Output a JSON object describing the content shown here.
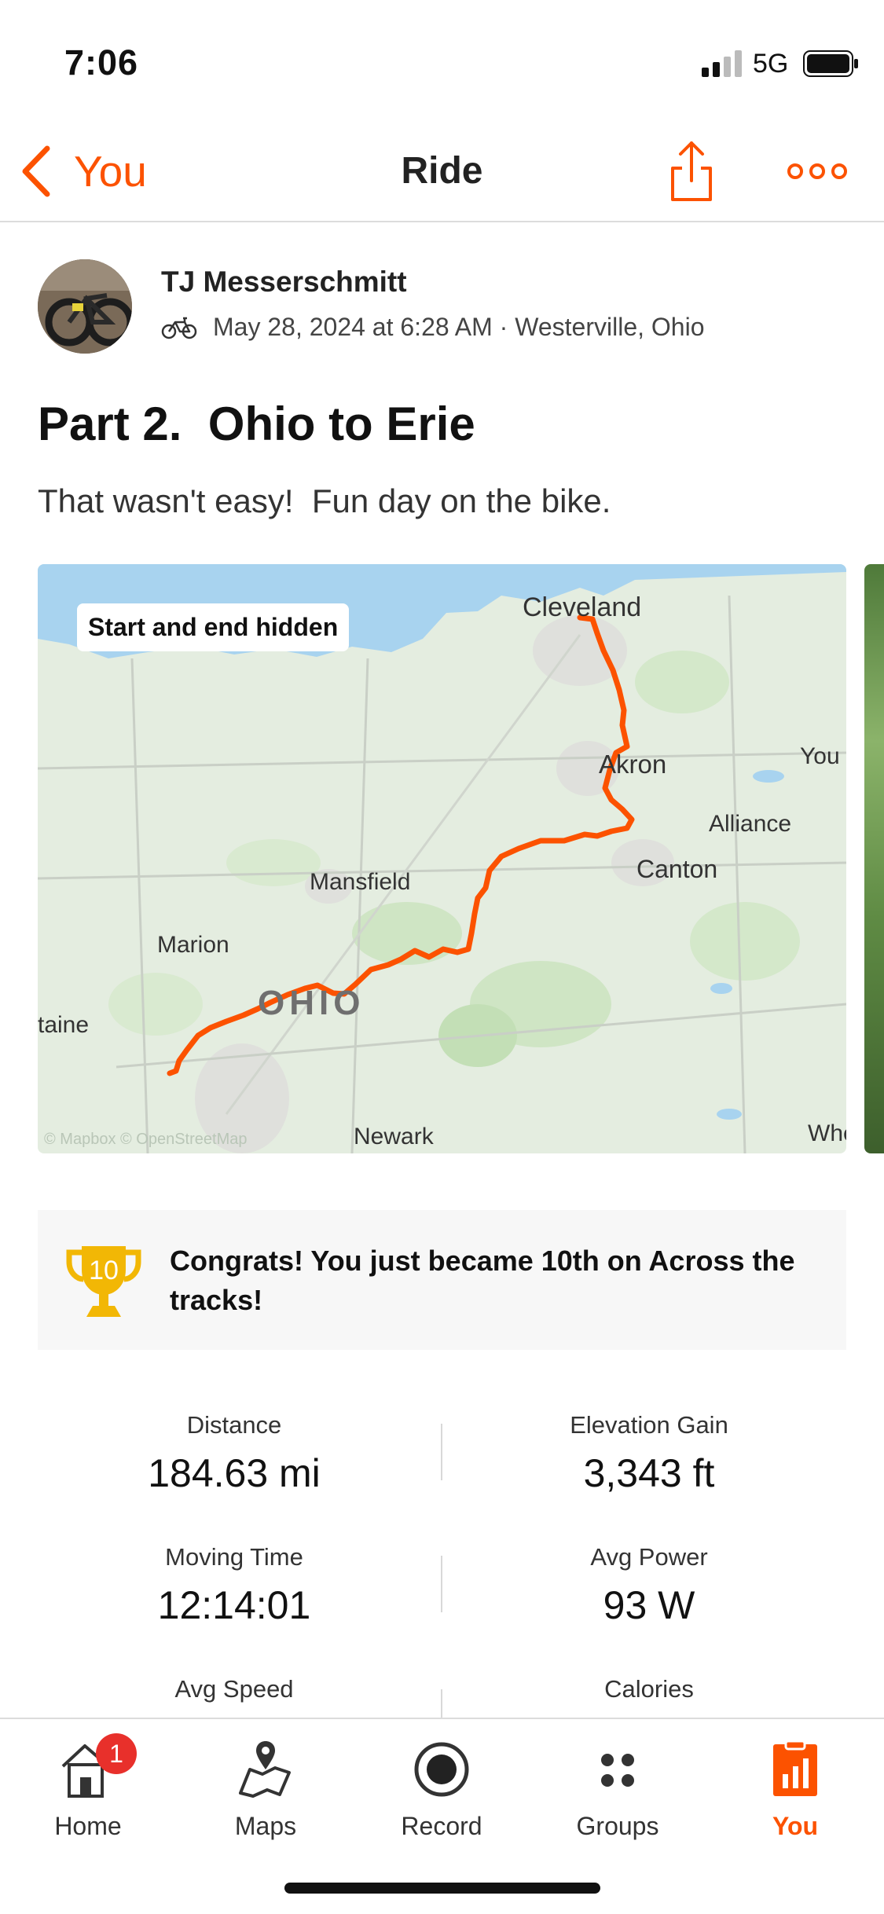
{
  "status_bar": {
    "time": "7:06",
    "network": "5G"
  },
  "nav": {
    "back_label": "You",
    "title": "Ride"
  },
  "athlete": {
    "name": "TJ Messerschmitt",
    "date_location": "May 28, 2024 at 6:28 AM · Westerville, Ohio"
  },
  "activity": {
    "title": "Part 2.  Ohio to Erie",
    "description": "That wasn't easy!  Fun day on the bike."
  },
  "map": {
    "badge": "Start and end hidden",
    "labels": {
      "cleveland": "Cleveland",
      "akron": "Akron",
      "youngstown": "You",
      "alliance": "Alliance",
      "canton": "Canton",
      "mansfield": "Mansfield",
      "marion": "Marion",
      "ohio": "OHIO",
      "bellefontaine": "taine",
      "newark": "Newark",
      "wheeling": "Whe"
    },
    "attribution": "© Mapbox © OpenStreetMap",
    "route_color": "#fc5200"
  },
  "achievement": {
    "rank": "10",
    "text": "Congrats! You just became 10th on Across the tracks!"
  },
  "stats": [
    {
      "label": "Distance",
      "value": "184.63 mi"
    },
    {
      "label": "Elevation Gain",
      "value": "3,343 ft"
    },
    {
      "label": "Moving Time",
      "value": "12:14:01"
    },
    {
      "label": "Avg Power",
      "value": "93 W"
    },
    {
      "label": "Avg Speed",
      "value": ""
    },
    {
      "label": "Calories",
      "value": ""
    }
  ],
  "tabs": [
    {
      "label": "Home",
      "badge": "1"
    },
    {
      "label": "Maps"
    },
    {
      "label": "Record"
    },
    {
      "label": "Groups"
    },
    {
      "label": "You"
    }
  ],
  "colors": {
    "accent": "#fc5200",
    "badge": "#e8302b",
    "trophy": "#f2b705"
  }
}
